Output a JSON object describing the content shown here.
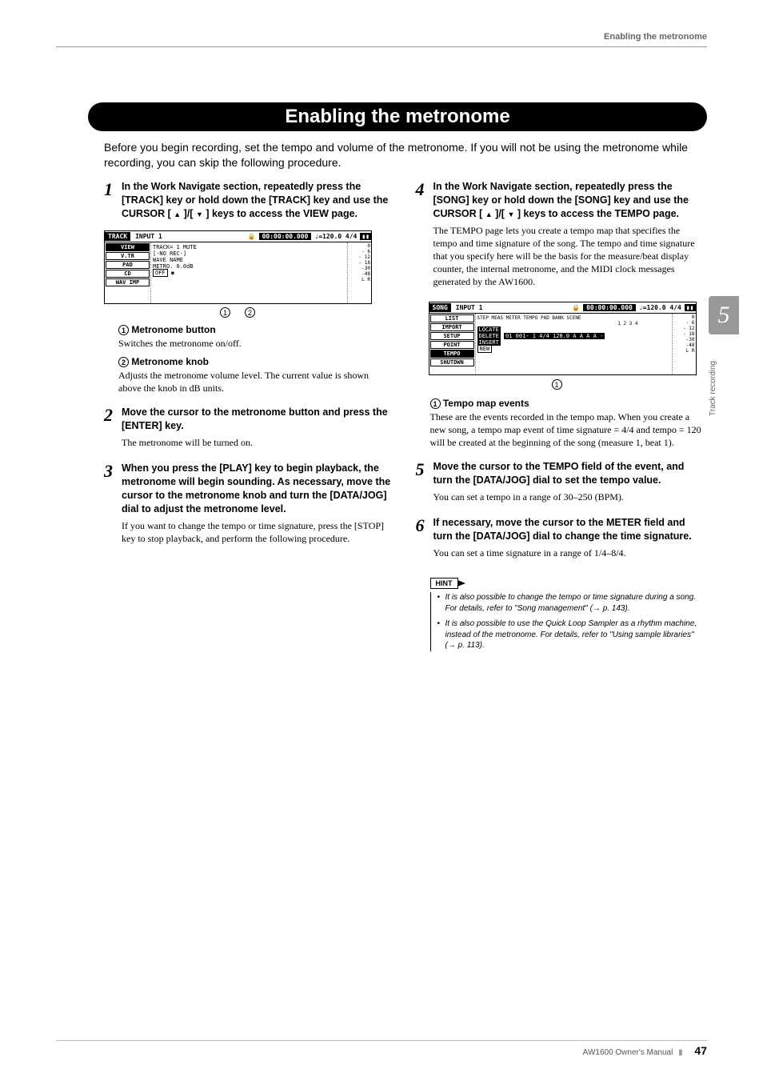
{
  "header": {
    "running": "Enabling the metronome"
  },
  "title": "Enabling the metronome",
  "intro": "Before you begin recording, set the tempo and volume of the metronome. If you will not be using the metronome while recording, you can skip the following procedure.",
  "left": {
    "step1": {
      "num": "1",
      "title_a": "In the Work Navigate section, repeatedly press the [TRACK] key or hold down the [TRACK] key and use the CURSOR [ ",
      "title_b": " ]/[ ",
      "title_c": " ] keys to access the VIEW page."
    },
    "ss1": {
      "corner": "TRACK",
      "input": "INPUT  1",
      "lock": "🔒",
      "time": "00:00:00.000",
      "tempo": "♩=120.0 4/4",
      "tabs": [
        "VIEW",
        "V.TR",
        "PAD",
        "CD",
        "WAV IMP"
      ],
      "mid1": "TRACK= 1  MUTE",
      "mid2": "[-NO REC-]",
      "mid3": "WAVE  NAME",
      "mid4": "METRO.   0.0dB",
      "mid5": "OFF",
      "meters": [
        "0",
        "- 6",
        "- 12",
        "- 18",
        "-30",
        "-48",
        "L R"
      ]
    },
    "callouts": {
      "c1": "1",
      "c2": "2"
    },
    "sub1": {
      "num": "1",
      "title": "Metronome button",
      "text": "Switches the metronome on/off."
    },
    "sub2": {
      "num": "2",
      "title": "Metronome knob",
      "text": "Adjusts the metronome volume level. The current value is shown above the knob in dB units."
    },
    "step2": {
      "num": "2",
      "title": "Move the cursor to the metronome button and press the [ENTER] key.",
      "text": "The metronome will be turned on."
    },
    "step3": {
      "num": "3",
      "title": "When you press the [PLAY] key to begin playback, the metronome will begin sounding. As necessary, move the cursor to the metronome knob and turn the [DATA/JOG] dial to adjust the metronome level.",
      "text": "If you want to change the tempo or time signature, press the [STOP] key to stop playback, and perform the following procedure."
    }
  },
  "right": {
    "step4": {
      "num": "4",
      "title_a": "In the Work Navigate section, repeatedly press the [SONG] key or hold down the [SONG] key and use the CURSOR [ ",
      "title_b": " ]/[ ",
      "title_c": " ] keys to access the TEMPO page.",
      "text": "The TEMPO page lets you create a tempo map that specifies the tempo and time signature of the song. The tempo and time signature that you specify here will be the basis for the measure/beat display counter, the internal metronome, and the MIDI clock messages generated by the AW1600."
    },
    "ss2": {
      "corner": "SONG",
      "input": "INPUT  1",
      "lock": "🔒",
      "time": "00:00:00.000",
      "tempo": "♩=120.0 4/4",
      "tabs": [
        "LIST",
        "IMPORT",
        "SETUP",
        "POINT",
        "TEMPO",
        "SHUTDWN"
      ],
      "hdr": "STEP MEAS  METER TEMPO  PAD BANK SCENE",
      "hdr2": "1  2  3  4",
      "btn1": "LOCATE",
      "btn2": "DELETE",
      "row": "01 001- 1 4/4 120.0 A A A A  -",
      "btn3": "INSERT",
      "btn4": "NEW",
      "meters": [
        "0",
        "- 6",
        "- 12",
        "- 18",
        "-30",
        "-48",
        "L R"
      ]
    },
    "callout": {
      "c1": "1"
    },
    "sub1": {
      "num": "1",
      "title": "Tempo map events",
      "text": "These are the events recorded in the tempo map. When you create a new song, a tempo map event of time signature = 4/4 and tempo = 120 will be created at the beginning of the song (measure 1, beat 1)."
    },
    "step5": {
      "num": "5",
      "title": "Move the cursor to the TEMPO field of the event, and turn the [DATA/JOG] dial to set the tempo value.",
      "text": "You can set a tempo in a range of 30–250 (BPM)."
    },
    "step6": {
      "num": "6",
      "title": "If necessary, move the cursor to the METER field and turn the [DATA/JOG] dial to change the time signature.",
      "text": "You can set a time signature in a range of 1/4–8/4."
    },
    "hint": {
      "label": "HINT",
      "b1": "It is also possible to change the tempo or time signature during a song. For details, refer to \"Song management\" (→ p. 143).",
      "b2": "It is also possible to use the Quick Loop Sampler as a rhythm machine, instead of the metronome. For details, refer to \"Using sample libraries\" (→ p. 113)."
    }
  },
  "sidetab": {
    "chapter": "5",
    "label": "Track recording"
  },
  "footer": {
    "manual": "AW1600  Owner's Manual",
    "page": "47"
  }
}
